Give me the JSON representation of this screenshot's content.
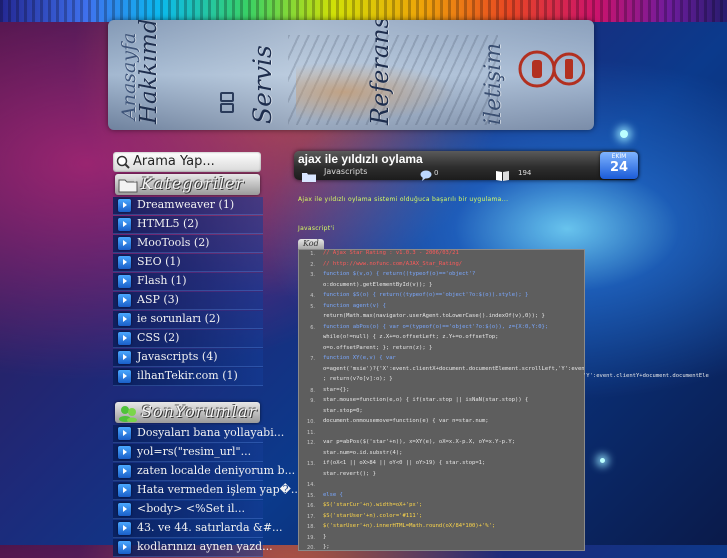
{
  "header": {
    "nav": [
      {
        "label": "Anasayfa"
      },
      {
        "label": "Hakkımda"
      },
      {
        "label": "Servis"
      },
      {
        "label": "Referans"
      },
      {
        "label": "iletişim"
      }
    ],
    "pb_icon_text": "ü"
  },
  "sidebar": {
    "search_placeholder": "Arama Yap...",
    "categories_title": "Kategoriler",
    "categories": [
      {
        "label": "Dreamweaver (1)"
      },
      {
        "label": "HTML5 (2)"
      },
      {
        "label": "MooTools (2)"
      },
      {
        "label": "SEO (1)"
      },
      {
        "label": "Flash (1)"
      },
      {
        "label": "ASP (3)"
      },
      {
        "label": "ie sorunları (2)"
      },
      {
        "label": "CSS (2)"
      },
      {
        "label": "Javascripts (4)"
      },
      {
        "label": "ilhanTekir.com (1)"
      }
    ],
    "comments_title": "SonYorumlar",
    "comments": [
      {
        "label": "Dosyaları bana yollayabi..."
      },
      {
        "label": "yol=rs(\"resim_url\"..."
      },
      {
        "label": "zaten localde deniyorum b..."
      },
      {
        "label": "Hata vermeden işlem yap�..."
      },
      {
        "label": "<body> <%Set il..."
      },
      {
        "label": "43. ve 44. satırlarda &#..."
      },
      {
        "label": "kodlarınızı aynen yazd..."
      }
    ]
  },
  "post": {
    "title": "ajax ile yıldızlı oylama",
    "category": "Javascripts",
    "comments_count": "0",
    "views": "194",
    "date_month": "EKİM",
    "date_day": "24",
    "intro": "Ajax ile yıldızlı oylama sistemi olduğuca başarılı bir uygulama...",
    "subheading": "Javascript'i",
    "code_tab": "Kod",
    "code_lines": [
      {
        "n": "1.",
        "text": "// Ajax Star Rating : v1.0.3 - 2006/03/21",
        "style": "comment"
      },
      {
        "n": "2.",
        "text": "// http://www.nofunc.com/AJAX_Star_Rating/",
        "style": "comment"
      },
      {
        "n": "3.",
        "text": "function $(v,o) { return((typeof(o)=='object'?",
        "style": "kw"
      },
      {
        "n": "",
        "text": "o:document).getElementById(v)); }",
        "style": "plain"
      },
      {
        "n": "4.",
        "text": "function $S(o) { return((typeof(o)=='object'?o:$(o)).style); }",
        "style": "kw"
      },
      {
        "n": "5.",
        "text": "function agent(v) {",
        "style": "kw"
      },
      {
        "n": "",
        "text": "return(Math.max(navigator.userAgent.toLowerCase().indexOf(v),0)); }",
        "style": "plain"
      },
      {
        "n": "6.",
        "text": "function abPos(o) { var o=(typeof(o)=='object'?o:$(o)), z={X:0,Y:0};",
        "style": "kw"
      },
      {
        "n": "",
        "text": "while(o!=null) { z.X+=o.offsetLeft; z.Y+=o.offsetTop;",
        "style": "plain"
      },
      {
        "n": "",
        "text": "o=o.offsetParent; }; return(z); }",
        "style": "plain"
      },
      {
        "n": "7.",
        "text": "function XY(e,v) { var",
        "style": "kw"
      },
      {
        "n": "",
        "text": "o=agent('msie')?{'X':event.clientX+document.documentElement.scrollLeft,'Y':event.clientY+document.documentElem",
        "style": "plain"
      },
      {
        "n": "",
        "text": "; return(v?o[v]:o); }",
        "style": "plain"
      },
      {
        "n": "8.",
        "text": "star={};",
        "style": "plain"
      },
      {
        "n": "9.",
        "text": "star.mouse=function(e,o) { if(star.stop || isNaN(star.stop)) {",
        "style": "plain"
      },
      {
        "n": "",
        "text": "star.stop=0;",
        "style": "plain"
      },
      {
        "n": "10.",
        "text": "    document.onmousemove=function(e) { var n=star.num;",
        "style": "plain"
      },
      {
        "n": "11.",
        "text": "",
        "style": "plain"
      },
      {
        "n": "12.",
        "text": "        var p=abPos($('star'+n)), x=XY(e), oX=x.X-p.X, oY=x.Y-p.Y;",
        "style": "plain"
      },
      {
        "n": "",
        "text": "star.num=o.id.substr(4);",
        "style": "plain"
      },
      {
        "n": "13.",
        "text": "        if(oX<1 || oX>84 || oY<0 || oY>19) { star.stop=1;",
        "style": "plain"
      },
      {
        "n": "",
        "text": "star.revert(); }",
        "style": "plain"
      },
      {
        "n": "14.",
        "text": "",
        "style": "plain"
      },
      {
        "n": "15.",
        "text": "        else {",
        "style": "kw"
      },
      {
        "n": "16.",
        "text": "            $S('starCur'+n).width=oX+'px';",
        "style": "str"
      },
      {
        "n": "17.",
        "text": "            $S('starUser'+n).color='#111';",
        "style": "str"
      },
      {
        "n": "18.",
        "text": "            $('starUser'+n).innerHTML=Math.round(oX/84*100)+'%';",
        "style": "str"
      },
      {
        "n": "19.",
        "text": "        }",
        "style": "plain"
      },
      {
        "n": "20.",
        "text": "    };",
        "style": "plain"
      }
    ],
    "code_overflow": "'Y':event.clientY+document.documentEle"
  }
}
